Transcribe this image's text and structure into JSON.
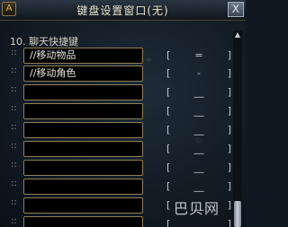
{
  "window": {
    "title": "键盘设置窗口(无)",
    "close_label": "X",
    "corner_icon_label": "A"
  },
  "section": {
    "label": "10. 聊天快捷键"
  },
  "rows": [
    {
      "value": "//移动物品",
      "key": "="
    },
    {
      "value": "//移动角色",
      "key": "-"
    },
    {
      "value": "",
      "key": "__"
    },
    {
      "value": "",
      "key": "__"
    },
    {
      "value": "",
      "key": "__"
    },
    {
      "value": "",
      "key": "__"
    },
    {
      "value": "",
      "key": "__"
    },
    {
      "value": "",
      "key": "__"
    },
    {
      "value": "",
      "key": "__"
    },
    {
      "value": "",
      "key": "__"
    }
  ],
  "bracket_left": "[",
  "bracket_right": "]",
  "watermark": "巴贝网"
}
